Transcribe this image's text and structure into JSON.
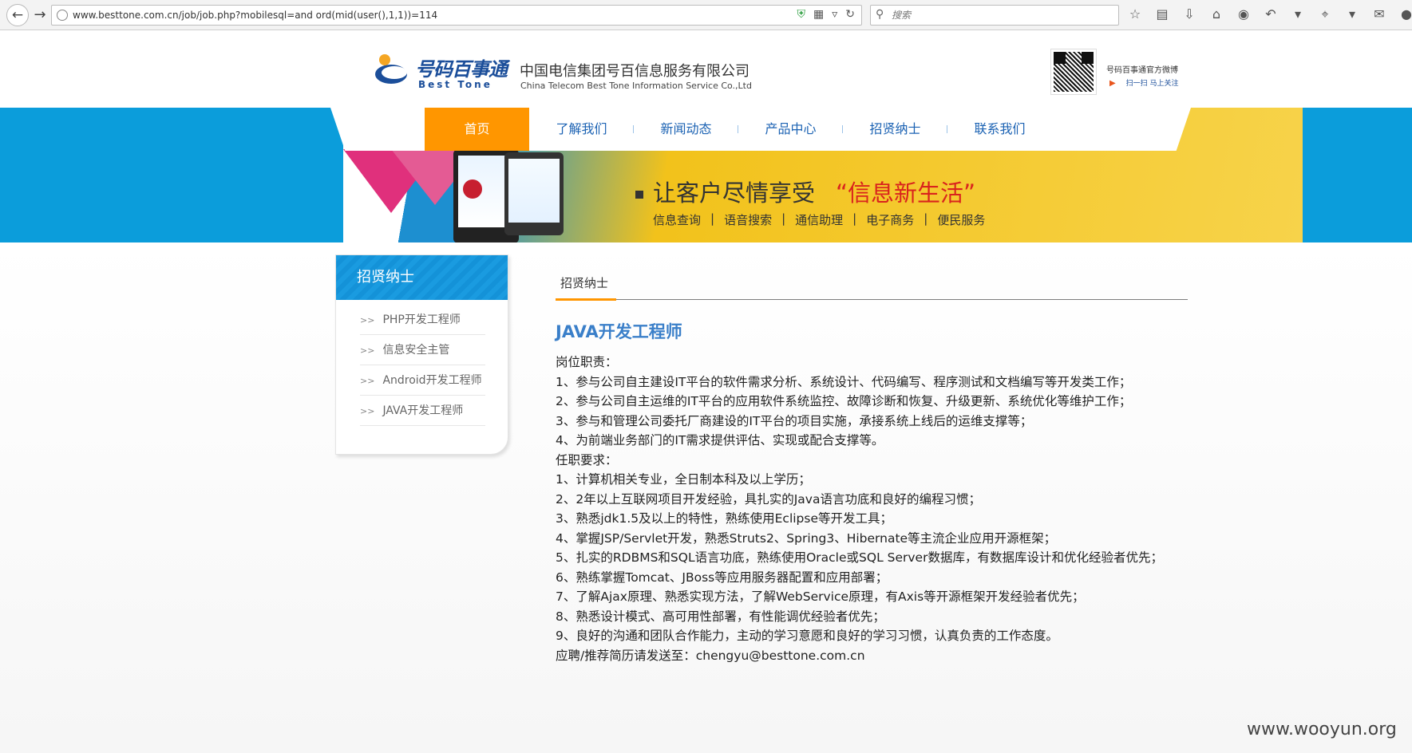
{
  "browser": {
    "url": "www.besttone.com.cn/job/job.php?mobilesql=and ord(mid(user(),1,1))=114",
    "search_placeholder": "搜索"
  },
  "header": {
    "logo_cn": "号码百事通",
    "logo_en": "Best Tone",
    "company_cn": "中国电信集团号百信息服务有限公司",
    "company_en": "China Telecom Best Tone Information Service Co.,Ltd",
    "weibo_title": "号码百事通官方微博",
    "weibo_scan": "扫一扫",
    "weibo_follow": "马上关注"
  },
  "nav": {
    "items": [
      {
        "label": "首页"
      },
      {
        "label": "了解我们"
      },
      {
        "label": "新闻动态"
      },
      {
        "label": "产品中心"
      },
      {
        "label": "招贤纳士"
      },
      {
        "label": "联系我们"
      }
    ]
  },
  "banner": {
    "slogan": "让客户尽情享受",
    "slogan_highlight": "“信息新生活”",
    "services": [
      "信息查询",
      "语音搜索",
      "通信助理",
      "电子商务",
      "便民服务"
    ],
    "sep": "|"
  },
  "sidebar": {
    "title": "招贤纳士",
    "marker": ">>",
    "items": [
      {
        "label": "PHP开发工程师"
      },
      {
        "label": "信息安全主管"
      },
      {
        "label": "Android开发工程师"
      },
      {
        "label": "JAVA开发工程师"
      }
    ]
  },
  "main": {
    "tab": "招贤纳士",
    "job_title": "JAVA开发工程师",
    "lines": [
      "岗位职责：",
      "1、参与公司自主建设IT平台的软件需求分析、系统设计、代码编写、程序测试和文档编写等开发类工作；",
      "2、参与公司自主运维的IT平台的应用软件系统监控、故障诊断和恢复、升级更新、系统优化等维护工作；",
      "3、参与和管理公司委托厂商建设的IT平台的项目实施，承接系统上线后的运维支撑等；",
      "4、为前端业务部门的IT需求提供评估、实现或配合支撑等。",
      "任职要求：",
      "1、计算机相关专业，全日制本科及以上学历；",
      "2、2年以上互联网项目开发经验，具扎实的Java语言功底和良好的编程习惯；",
      "3、熟悉jdk1.5及以上的特性，熟练使用Eclipse等开发工具；",
      "4、掌握JSP/Servlet开发，熟悉Struts2、Spring3、Hibernate等主流企业应用开源框架；",
      "5、扎实的RDBMS和SQL语言功底，熟练使用Oracle或SQL Server数据库，有数据库设计和优化经验者优先；",
      "6、熟练掌握Tomcat、JBoss等应用服务器配置和应用部署；",
      "7、了解Ajax原理、熟悉实现方法，了解WebService原理，有Axis等开源框架开发经验者优先；",
      "8、熟悉设计模式、高可用性部署，有性能调优经验者优先；",
      "9、良好的沟通和团队合作能力，主动的学习意愿和良好的学习习惯，认真负责的工作态度。",
      "应聘/推荐简历请发送至：chengyu@besttone.com.cn"
    ]
  },
  "watermark": "www.wooyun.org",
  "colors": {
    "accent_orange": "#ff9600",
    "nav_blue": "#1b62b3",
    "banner_blue": "#0b9ddb",
    "title_blue": "#3a7fc9",
    "slogan_red": "#d9231d"
  }
}
